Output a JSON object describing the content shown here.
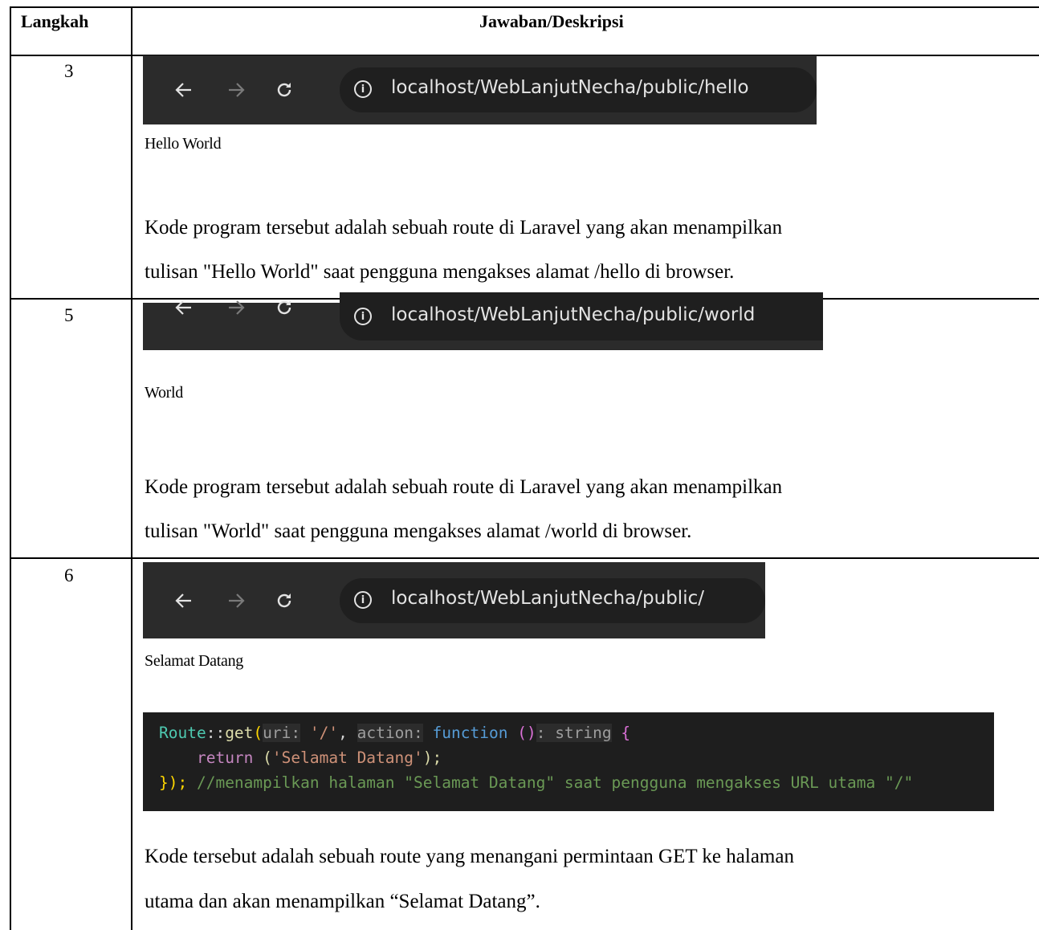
{
  "table": {
    "header": {
      "step": "Langkah",
      "answer": "Jawaban/Deskripsi"
    },
    "rows": [
      {
        "step": "3",
        "browser_url": "localhost/WebLanjutNecha/public/hello",
        "page_output": "Hello World",
        "description_line1": "Kode program tersebut adalah  sebuah  route  di Laravel yang akan menampilkan",
        "description_line2": "tulisan \"Hello World\" saat pengguna mengakses alamat /hello di browser."
      },
      {
        "step": "5",
        "browser_url": "localhost/WebLanjutNecha/public/world",
        "page_output": "World",
        "description_line1": "Kode program tersebut adalah  sebuah  route  di Laravel yang akan menampilkan",
        "description_line2": "tulisan \"World\" saat pengguna mengakses alamat /world di browser."
      },
      {
        "step": "6",
        "browser_url": "localhost/WebLanjutNecha/public/",
        "page_output": "Selamat Datang",
        "code": {
          "line1": {
            "cls": "Route",
            "sep": "::",
            "fn": "get",
            "open": "(",
            "hint1": "uri:",
            "arg1": "'/'",
            "comma": ", ",
            "hint2": "action:",
            "kw": "function",
            "parens": " ()",
            "colon": ": ",
            "type": "string",
            "brace": " {"
          },
          "line2": {
            "indent": "    ",
            "ret": "return",
            "call": " (",
            "arg": "'Selamat Datang'",
            "close": ");"
          },
          "line3": {
            "close": "});",
            "comment": " //menampilkan halaman \"Selamat Datang\" saat pengguna mengakses URL utama \"/\""
          }
        },
        "description_line1": "Kode tersebut adalah sebuah route yang menangani permintaan GET ke halaman",
        "description_line2": "utama dan akan  menampilkan “Selamat Datang”."
      }
    ]
  },
  "icons": {
    "back": "arrow-left-icon",
    "forward": "arrow-right-icon",
    "reload": "reload-icon",
    "info": "info-icon"
  },
  "colors": {
    "browser_bar": "#2b2b2b",
    "url_pill": "#1f1f1f",
    "code_bg": "#1e1e1e"
  }
}
